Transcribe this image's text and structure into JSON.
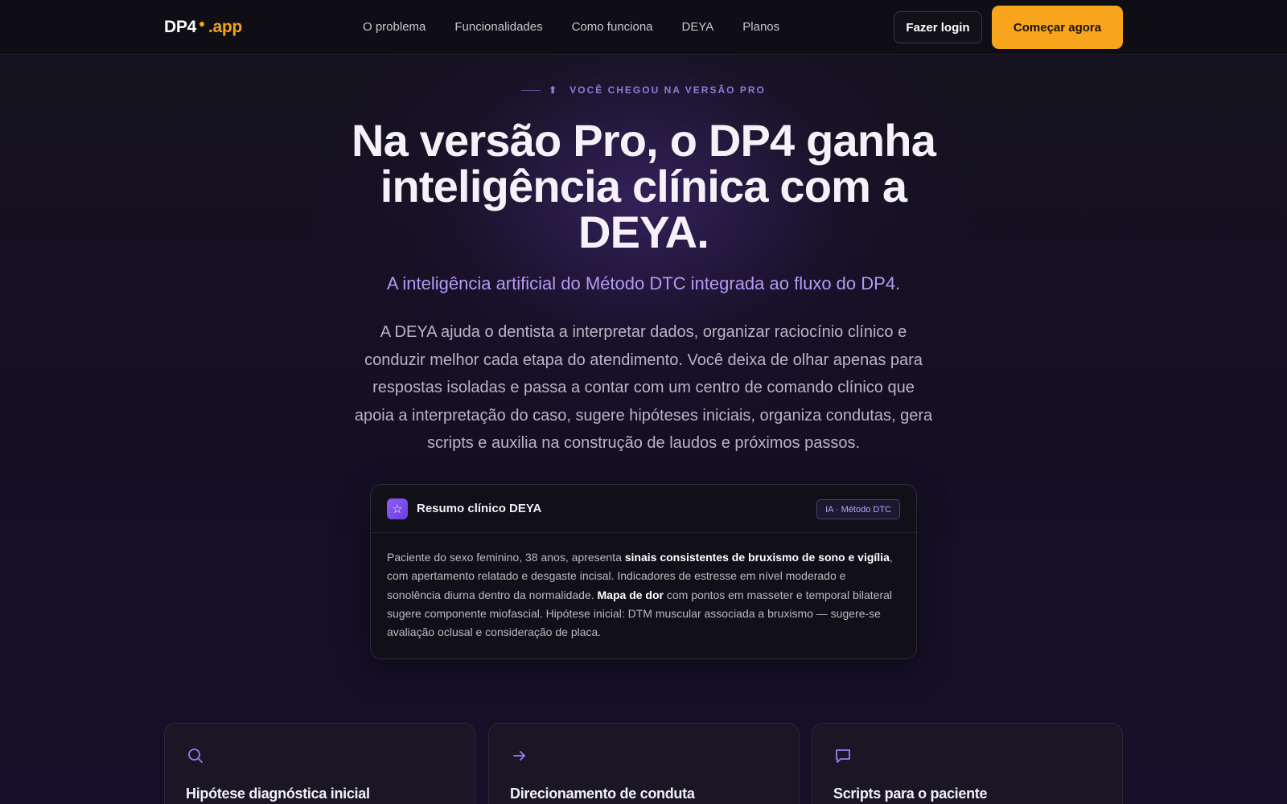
{
  "nav": {
    "logo_main": "DP4",
    "logo_suffix": ".app",
    "links": [
      "O problema",
      "Funcionalidades",
      "Como funciona",
      "DEYA",
      "Planos"
    ],
    "login_label": "Fazer login",
    "cta_label": "Começar agora"
  },
  "hero": {
    "eyebrow": "VOCÊ CHEGOU NA VERSÃO PRO",
    "title": "Na versão Pro, o DP4 ganha inteligência clínica com a DEYA.",
    "subtitle": "A inteligência artificial do Método DTC integrada ao fluxo do DP4.",
    "description": "A DEYA ajuda o dentista a interpretar dados, organizar raciocínio clínico e conduzir melhor cada etapa do atendimento. Você deixa de olhar apenas para respostas isoladas e passa a contar com um centro de comando clínico que apoia a interpretação do caso, sugere hipóteses iniciais, organiza condutas, gera scripts e auxilia na construção de laudos e próximos passos."
  },
  "summary_card": {
    "title": "Resumo clínico DEYA",
    "badge": "IA · Método DTC",
    "text_1": "Paciente do sexo feminino, 38 anos, apresenta ",
    "bold_1": "sinais consistentes de bruxismo de sono e vigília",
    "text_2": ", com apertamento relatado e desgaste incisal. Indicadores de estresse em nível moderado e sonolência diurna dentro da normalidade. ",
    "bold_2": "Mapa de dor",
    "text_3": " com pontos em masseter e temporal bilateral sugere componente miofascial. Hipótese inicial: DTM muscular associada a bruxismo — sugere-se avaliação oclusal e consideração de placa."
  },
  "features": [
    {
      "icon": "search-icon",
      "title": "Hipótese diagnóstica inicial"
    },
    {
      "icon": "arrow-right-icon",
      "title": "Direcionamento de conduta"
    },
    {
      "icon": "chat-bubble-icon",
      "title": "Scripts para o paciente"
    }
  ],
  "colors": {
    "accent_orange": "#f7a51c",
    "accent_purple": "#8b5cf6",
    "background": "#120f1d"
  }
}
